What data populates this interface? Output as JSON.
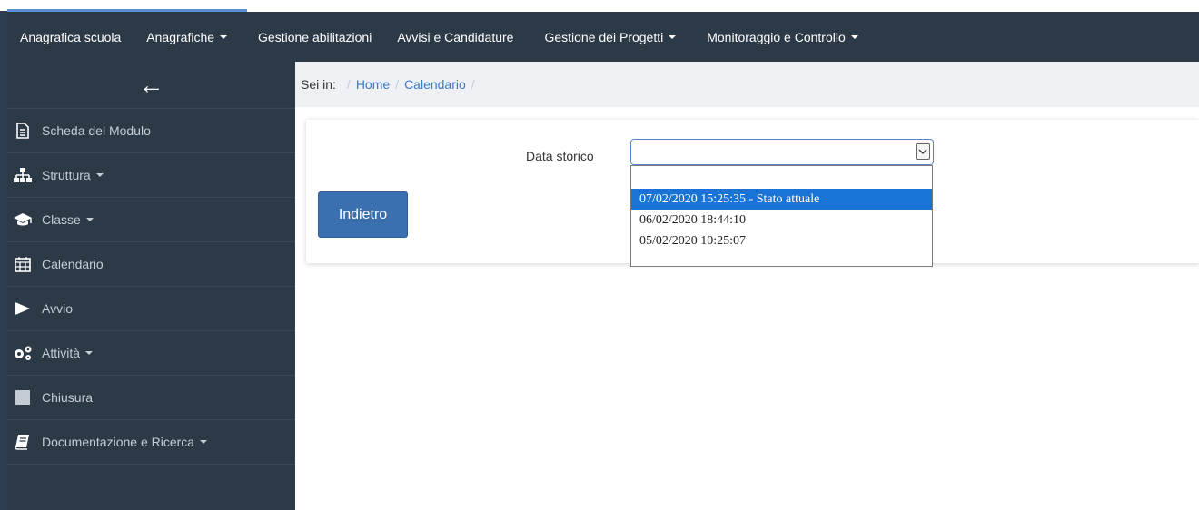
{
  "topnav": {
    "items": [
      {
        "label": "Anagrafica scuola",
        "dropdown": false
      },
      {
        "label": "Anagrafiche",
        "dropdown": true
      },
      {
        "label": "Gestione abilitazioni",
        "dropdown": false
      },
      {
        "label": "Avvisi e Candidature",
        "dropdown": false
      },
      {
        "label": "Gestione dei Progetti",
        "dropdown": true
      },
      {
        "label": "Monitoraggio e Controllo",
        "dropdown": true
      }
    ]
  },
  "sidebar": {
    "back_icon": "←",
    "items": [
      {
        "label": "Scheda del Modulo",
        "icon": "document-icon",
        "dropdown": false
      },
      {
        "label": "Struttura",
        "icon": "sitemap-icon",
        "dropdown": true
      },
      {
        "label": "Classe",
        "icon": "graduation-cap-icon",
        "dropdown": true
      },
      {
        "label": "Calendario",
        "icon": "calendar-icon",
        "dropdown": false
      },
      {
        "label": "Avvio",
        "icon": "play-icon",
        "dropdown": false
      },
      {
        "label": "Attività",
        "icon": "gears-icon",
        "dropdown": true
      },
      {
        "label": "Chiusura",
        "icon": "stop-icon",
        "dropdown": false
      },
      {
        "label": "Documentazione e Ricerca",
        "icon": "book-icon",
        "dropdown": true
      }
    ]
  },
  "breadcrumb": {
    "prefix": "Sei in:",
    "links": [
      "Home",
      "Calendario"
    ]
  },
  "form": {
    "label": "Data storico",
    "value": "",
    "options": [
      {
        "label": "",
        "selected": false
      },
      {
        "label": "07/02/2020 15:25:35 - Stato attuale",
        "selected": true
      },
      {
        "label": "06/02/2020 18:44:10",
        "selected": false
      },
      {
        "label": "05/02/2020 10:25:07",
        "selected": false
      }
    ],
    "back_button": "Indietro"
  },
  "colors": {
    "navbar": "#2c3a48",
    "accent": "#5b8fd6",
    "link": "#3a7bc8",
    "button": "#3a6fb0",
    "selected_option": "#1a73d6"
  }
}
